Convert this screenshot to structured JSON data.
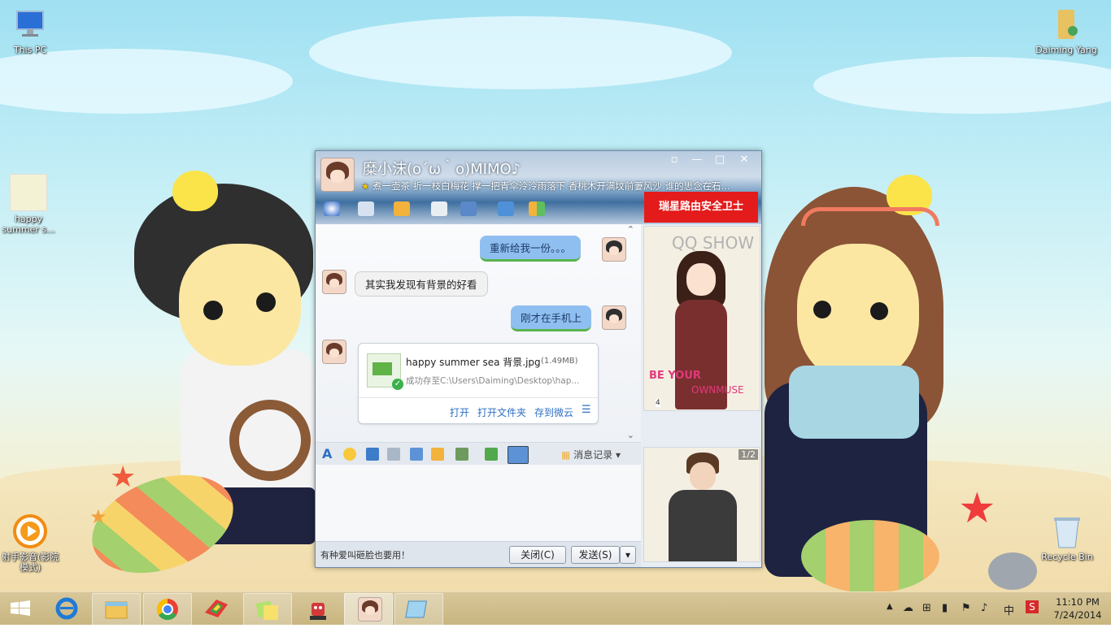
{
  "desktop": {
    "icons": [
      {
        "id": "this-pc",
        "label": "This PC"
      },
      {
        "id": "happy-summer",
        "label": "happy summer s..."
      },
      {
        "id": "player",
        "label": "射手影音(影院模式)"
      },
      {
        "id": "daiming",
        "label": "Daiming Yang"
      },
      {
        "id": "recycle",
        "label": "Recycle Bin"
      }
    ]
  },
  "chat_window": {
    "title": "糜小沫(o´ω｀o)MIMO♪",
    "signature": "煮一壶茶 折一枝白梅花 撑一把青伞泠泠雨落下 香桃木开满坟前萋风沙 谁的思念在石...",
    "ad_banner": "瑞星路由安全卫士",
    "messages": [
      {
        "dir": "out",
        "text": "重新给我一份。。。"
      },
      {
        "dir": "in",
        "text": "其实我发现有背景的好看"
      },
      {
        "dir": "out",
        "text": "刚才在手机上"
      }
    ],
    "file": {
      "name": "happy summer sea 背景.jpg",
      "size": "(1.49MB)",
      "status": "成功存至C:\\Users\\Daiming\\Desktop\\hap...",
      "actions": [
        "打开",
        "打开文件夹",
        "存到微云"
      ]
    },
    "toolbar": {
      "history_label": "消息记录"
    },
    "input_text": "",
    "bottom_tip": "有种爱叫砸脸也要用！",
    "close_button": "关闭(C)",
    "send_button": "发送(S)",
    "side": {
      "show_text": "QQ SHOW",
      "page_indicator": "1/2",
      "magazine_text_1": "BE YOUR",
      "magazine_text_2": "OWNMUSE",
      "page_number": "4"
    }
  },
  "taskbar": {
    "clock_time": "11:10 PM",
    "clock_date": "7/24/2014",
    "ime_label": "中",
    "brand_colors": {
      "ad_red": "#e41b1b",
      "bubble_blue": "#8fbff0",
      "accent_green": "#59b34f"
    }
  }
}
